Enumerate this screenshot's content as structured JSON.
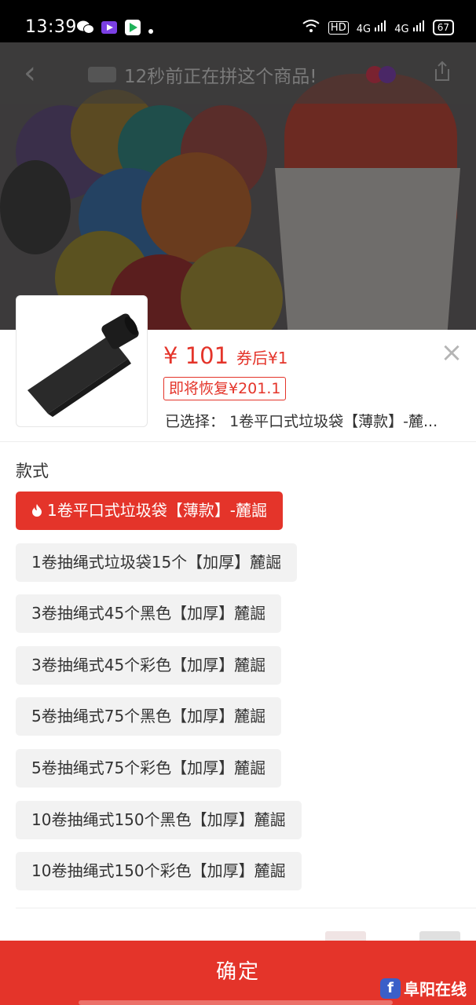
{
  "status_bar": {
    "time": "13:39",
    "left_icons": [
      "wechat-icon",
      "video-app-icon",
      "play-store-icon",
      "dot-icon"
    ],
    "right_labels": [
      "HD",
      "4G",
      "4G"
    ],
    "battery": "67"
  },
  "nav": {
    "ticker_text": "12秒前正在拼这个商品!"
  },
  "product": {
    "price": "¥ 101",
    "coupon_price": "券后¥1",
    "restore_badge": "即将恢复¥201.1",
    "selected_label": "已选择：",
    "selected_value": "1卷平口式垃圾袋【薄款】-麓...",
    "close_symbol": "×"
  },
  "section": {
    "title": "款式"
  },
  "options": [
    {
      "label": "1卷平口式垃圾袋【薄款】-麓誳",
      "selected": true
    },
    {
      "label": "1卷抽绳式垃圾袋15个【加厚】麓誳",
      "selected": false
    },
    {
      "label": "3卷抽绳式45个黑色【加厚】麓誳",
      "selected": false
    },
    {
      "label": "3卷抽绳式45个彩色【加厚】麓誳",
      "selected": false
    },
    {
      "label": "5卷抽绳式75个黑色【加厚】麓誳",
      "selected": false
    },
    {
      "label": "5卷抽绳式75个彩色【加厚】麓誳",
      "selected": false
    },
    {
      "label": "10卷抽绳式150个黑色【加厚】麓誳",
      "selected": false
    },
    {
      "label": "10卷抽绳式150个彩色【加厚】麓誳",
      "selected": false
    }
  ],
  "confirm_label": "确定",
  "watermark": {
    "logo": "f",
    "text": "阜阳在线"
  },
  "colors": {
    "accent": "#e4342a",
    "option_bg": "#f2f2f2"
  }
}
